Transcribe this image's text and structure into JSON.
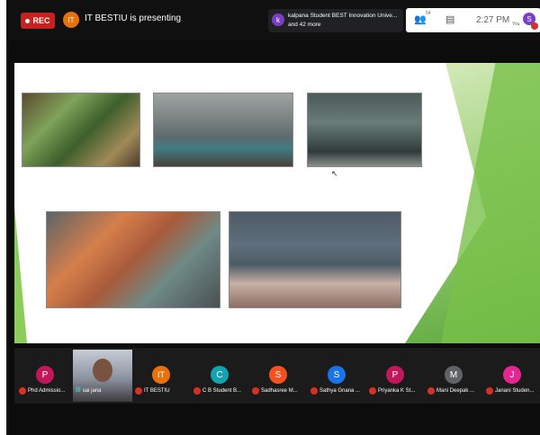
{
  "topbar": {
    "rec_label": "REC",
    "presenter_initials": "IT",
    "presenting_text": "IT BESTIU is presenting",
    "chip_initial": "k",
    "chip_line1": "kalpana Student BEST Innovation Unive...",
    "chip_line2": "and 42 more",
    "people_count": "54",
    "time": "2:27 PM",
    "you_label": "You",
    "you_initial": "S"
  },
  "slide": {
    "photos": [
      "leaves-photo",
      "boat-photo",
      "river-photo",
      "idols-photo",
      "litter-photo"
    ]
  },
  "participants": [
    {
      "initial": "P",
      "name": "Phd Admissio...",
      "color": "#c2185b"
    },
    {
      "initial": "",
      "name": "sai jana",
      "color": "",
      "video": true
    },
    {
      "initial": "IT",
      "name": "IT BESTIU",
      "color": "#e8710a"
    },
    {
      "initial": "C",
      "name": "C B Student B...",
      "color": "#12a4af"
    },
    {
      "initial": "S",
      "name": "Sadhasree M...",
      "color": "#f4511e"
    },
    {
      "initial": "S",
      "name": "Sathya Gnana ...",
      "color": "#1a73e8"
    },
    {
      "initial": "P",
      "name": "Priyanka K St...",
      "color": "#c2185b"
    },
    {
      "initial": "M",
      "name": "Mani Deepak ...",
      "color": "#5f6368"
    },
    {
      "initial": "J",
      "name": "Janani Studen...",
      "color": "#e52592"
    }
  ]
}
